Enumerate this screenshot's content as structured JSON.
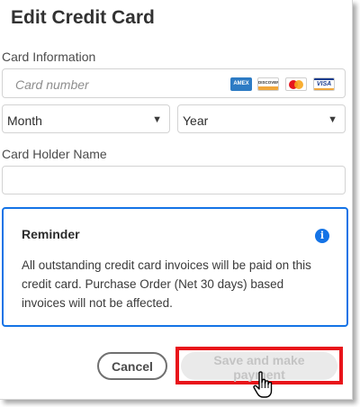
{
  "dialog": {
    "title": "Edit Credit Card"
  },
  "card_info": {
    "label": "Card Information",
    "card_number_placeholder": "Card number",
    "logos": [
      {
        "name": "amex",
        "text": "AMEX",
        "color": "#2d7bc4"
      },
      {
        "name": "discover",
        "text": "DISCOVER",
        "color": "#f0a73c"
      },
      {
        "name": "mastercard",
        "text": "",
        "color": "#f7a51c"
      },
      {
        "name": "visa",
        "text": "VISA",
        "color": "#1a3c8f"
      }
    ]
  },
  "expiry": {
    "month_label": "Month",
    "year_label": "Year"
  },
  "holder": {
    "label": "Card Holder Name",
    "value": ""
  },
  "reminder": {
    "title": "Reminder",
    "text": "All outstanding credit card invoices will be paid on this credit card. Purchase Order (Net 30 days) based invoices will not be affected."
  },
  "actions": {
    "cancel_label": "Cancel",
    "save_label": "Save and make payment"
  },
  "colors": {
    "accent": "#1473e6",
    "highlight": "#e8141a"
  }
}
